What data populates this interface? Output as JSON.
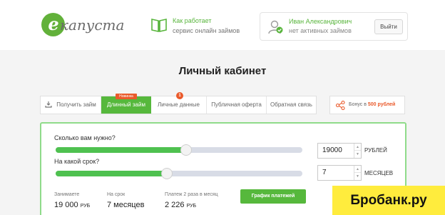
{
  "header": {
    "logo_text": "капуста",
    "logo_letter": "e",
    "how_it_works": {
      "title": "Как работает",
      "subtitle": "сервис онлайн займов",
      "icon": "book-icon"
    },
    "user": {
      "name": "Иван Александрович",
      "status": "нет активных займов",
      "icon": "user-check-icon",
      "logout_label": "Выйти"
    }
  },
  "page_title": "Личный кабинет",
  "tabs": [
    {
      "label": "Получить займ",
      "icon": "download-icon",
      "active": false
    },
    {
      "label": "Длинный займ",
      "active": true,
      "badge": "Новинка"
    },
    {
      "label": "Личные данные",
      "active": false,
      "badge_count": "1"
    },
    {
      "label": "Публичная оферта",
      "active": false
    },
    {
      "label": "Обратная связь",
      "active": false
    }
  ],
  "bonus": {
    "prefix": "Бонус в",
    "amount": "500 рублей",
    "icon": "share-icon"
  },
  "calculator": {
    "amount_question": "Сколько вам нужно?",
    "amount_value": "19000",
    "amount_unit": "РУБЛЕЙ",
    "amount_slider_fraction": 0.53,
    "term_question": "На какой срок?",
    "term_value": "7",
    "term_unit": "МЕСЯЦЕВ",
    "term_slider_fraction": 0.45,
    "summary": {
      "borrow_label": "Занимаете",
      "borrow_value": "19 000",
      "borrow_unit": "РУБ",
      "term_label": "На срок",
      "term_value": "7 месяцев",
      "payment_label": "Платеж 2 раза в месяц",
      "payment_value": "2 226",
      "payment_unit": "РУБ"
    },
    "schedule_button": "График платежей"
  },
  "watermark": "Бробанк.ру",
  "colors": {
    "brand_green": "#56b83c",
    "accent_orange": "#ea5a2b",
    "watermark_yellow": "#ffec3d"
  }
}
